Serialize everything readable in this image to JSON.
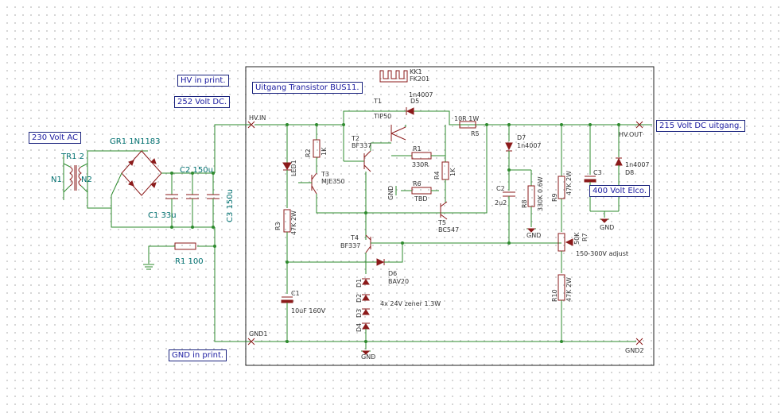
{
  "notes": {
    "hv_in_print": "HV in print.",
    "volt_252": "252 Volt DC.",
    "ac_230": "230 Volt AC",
    "uitgang_transistor": "Uitgang Transistor BUS11.",
    "dc_215_out": "215 Volt DC uitgang.",
    "elco_400": "400 Volt Elco.",
    "gnd_in_print": "GND in print."
  },
  "left": {
    "tr1": "TR1 2",
    "n1": "N1",
    "n2": "N2",
    "gr1": "GR1 1N1183",
    "c2": "C2 150u",
    "c1": "C1 33u",
    "c3": "C3 150u",
    "r1": "R1 100"
  },
  "board": {
    "hv_in": "HV.IN",
    "hv_out": "HV.OUT",
    "gnd1": "GND1",
    "gnd2": "GND2",
    "gnd": "GND",
    "kk1": "KK1",
    "fk201": "FK201",
    "t1": "T1",
    "tip50": "TIP50",
    "d5": "D5",
    "d5_val": "1n4007",
    "r5_val": "10R 1W",
    "r5": "R5",
    "t2": "T2",
    "t2_val": "BF337",
    "r2": "R2",
    "r2_val": "1K",
    "led1": "LED1",
    "t3": "T3",
    "t3_val": "MJE350",
    "r1b": "R1",
    "r1b_val": "330R",
    "r4": "R4",
    "r4_val": "1K",
    "r6": "R6",
    "r6_val": "TBD",
    "t5": "T5",
    "t5_val": "BC547",
    "r3": "R3",
    "r3_val": "47K 2W",
    "t4": "T4",
    "t4_val": "BF337",
    "d6": "D6",
    "d6_val": "BAV20",
    "c1b": "C1",
    "c1b_val": "10uF 160V",
    "d1": "D1",
    "d2": "D2",
    "d3": "D3",
    "d4": "D4",
    "zener": "4x 24V zener 1.3W",
    "d7": "D7",
    "d7_val": "1n4007",
    "c2b": "C2",
    "c2b_val": "2u2",
    "r8": "R8",
    "r8_val": "330K 0.6W",
    "r9": "R9",
    "r9_val": "47K 2W",
    "c3b": "C3",
    "d8": "D8",
    "d8_val": "1n4007",
    "r7": "R7",
    "r7_val": "50K",
    "adjust": "150-300V adjust",
    "r10": "R10",
    "r10_val": "47K 2W"
  }
}
